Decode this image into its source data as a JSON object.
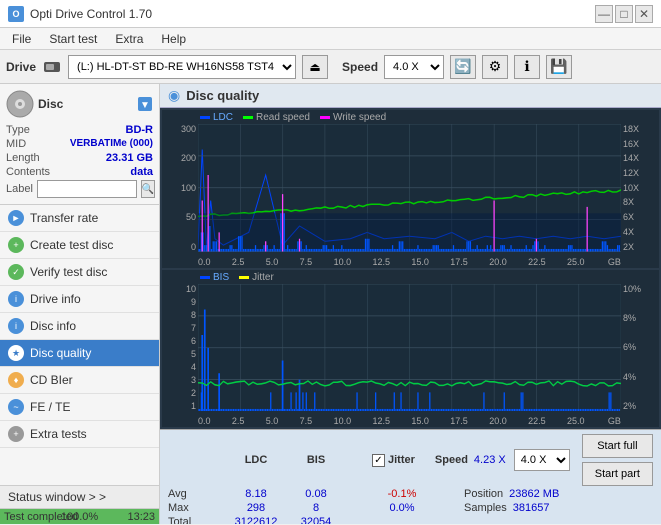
{
  "app": {
    "title": "Opti Drive Control 1.70",
    "icon": "O"
  },
  "titlebar": {
    "minimize": "—",
    "maximize": "□",
    "close": "✕"
  },
  "menubar": {
    "items": [
      "File",
      "Start test",
      "Extra",
      "Help"
    ]
  },
  "drivebar": {
    "label": "Drive",
    "drive_value": "(L:) HL-DT-ST BD-RE WH16NS58 TST4",
    "speed_label": "Speed",
    "speed_value": "4.0 X"
  },
  "disc": {
    "type_label": "Type",
    "type_value": "BD-R",
    "mid_label": "MID",
    "mid_value": "VERBATIMe (000)",
    "length_label": "Length",
    "length_value": "23.31 GB",
    "contents_label": "Contents",
    "contents_value": "data",
    "label_label": "Label"
  },
  "sidebar_menu": [
    {
      "id": "transfer-rate",
      "label": "Transfer rate",
      "icon": "►"
    },
    {
      "id": "create-test-disc",
      "label": "Create test disc",
      "icon": "+"
    },
    {
      "id": "verify-test-disc",
      "label": "Verify test disc",
      "icon": "✓"
    },
    {
      "id": "drive-info",
      "label": "Drive info",
      "icon": "i"
    },
    {
      "id": "disc-info",
      "label": "Disc info",
      "icon": "i"
    },
    {
      "id": "disc-quality",
      "label": "Disc quality",
      "icon": "★",
      "active": true
    },
    {
      "id": "cd-bier",
      "label": "CD BIer",
      "icon": "♦"
    },
    {
      "id": "fe-te",
      "label": "FE / TE",
      "icon": "~"
    },
    {
      "id": "extra-tests",
      "label": "Extra tests",
      "icon": "+"
    }
  ],
  "status_window": {
    "label": "Status window > >"
  },
  "progress": {
    "fill_percent": 100,
    "text": "100.0%",
    "status": "Test completed",
    "time": "13:23"
  },
  "disc_quality": {
    "title": "Disc quality",
    "chart1": {
      "legends": [
        {
          "label": "LDC",
          "color": "#0044ff"
        },
        {
          "label": "Read speed",
          "color": "#00ff00"
        },
        {
          "label": "Write speed",
          "color": "#ff00ff"
        }
      ],
      "y_labels_left": [
        "300",
        "200",
        "100",
        "50",
        "0"
      ],
      "y_labels_right": [
        "18X",
        "16X",
        "14X",
        "12X",
        "10X",
        "8X",
        "6X",
        "4X",
        "2X"
      ],
      "x_labels": [
        "0.0",
        "2.5",
        "5.0",
        "7.5",
        "10.0",
        "12.5",
        "15.0",
        "17.5",
        "20.0",
        "22.5",
        "25.0"
      ],
      "x_unit": "GB"
    },
    "chart2": {
      "legends": [
        {
          "label": "BIS",
          "color": "#0044ff"
        },
        {
          "label": "Jitter",
          "color": "#ffff00"
        }
      ],
      "y_labels_left": [
        "10",
        "9",
        "8",
        "7",
        "6",
        "5",
        "4",
        "3",
        "2",
        "1"
      ],
      "y_labels_right": [
        "10%",
        "8%",
        "6%",
        "4%",
        "2%"
      ],
      "x_labels": [
        "0.0",
        "2.5",
        "5.0",
        "7.5",
        "10.0",
        "12.5",
        "15.0",
        "17.5",
        "20.0",
        "22.5",
        "25.0"
      ],
      "x_unit": "GB"
    }
  },
  "stats": {
    "columns": [
      "LDC",
      "BIS",
      "",
      "Jitter",
      "Speed"
    ],
    "avg_label": "Avg",
    "avg_ldc": "8.18",
    "avg_bis": "0.08",
    "avg_jitter": "-0.1%",
    "max_label": "Max",
    "max_ldc": "298",
    "max_bis": "8",
    "max_jitter": "0.0%",
    "total_label": "Total",
    "total_ldc": "3122612",
    "total_bis": "32054",
    "speed_label": "Speed",
    "speed_value": "4.23 X",
    "speed_select": "4.0 X",
    "position_label": "Position",
    "position_value": "23862 MB",
    "samples_label": "Samples",
    "samples_value": "381657",
    "start_full": "Start full",
    "start_part": "Start part"
  }
}
